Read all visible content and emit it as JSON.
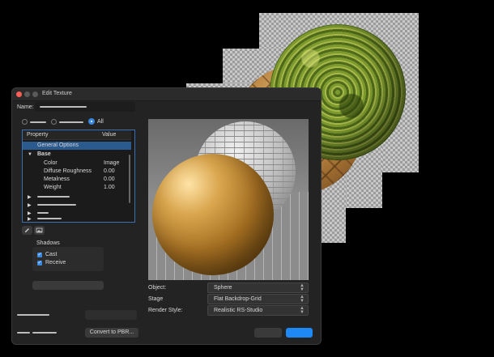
{
  "window": {
    "title": "Edit Texture"
  },
  "name_label": "Name:",
  "filter": {
    "all_label": "All"
  },
  "tree": {
    "col_property": "Property",
    "col_value": "Value",
    "general_options": "General Options",
    "base_group": "Base",
    "rows": [
      {
        "label": "Color",
        "value": "Image"
      },
      {
        "label": "Diffuse Roughness",
        "value": "0.00"
      },
      {
        "label": "Metalness",
        "value": "0.00"
      },
      {
        "label": "Weight",
        "value": "1.00"
      }
    ]
  },
  "icons": [
    "pencil-icon",
    "image-icon"
  ],
  "shadows": {
    "title": "Shadows",
    "cast_label": "Cast",
    "receive_label": "Receive",
    "cast_checked": true,
    "receive_checked": true
  },
  "scene": {
    "object_label": "Object:",
    "object_value": "Sphere",
    "stage_label": "Stage",
    "stage_value": "Flat Backdrop-Grid",
    "render_label": "Render Style:",
    "render_value": "Realistic RS-Studio"
  },
  "buttons": {
    "convert_label": "Convert to PBR..."
  },
  "colors": {
    "accent": "#3a87e0",
    "close": "#ff5f57",
    "gold": "#c8963a",
    "moss": "#6e8a2a"
  }
}
